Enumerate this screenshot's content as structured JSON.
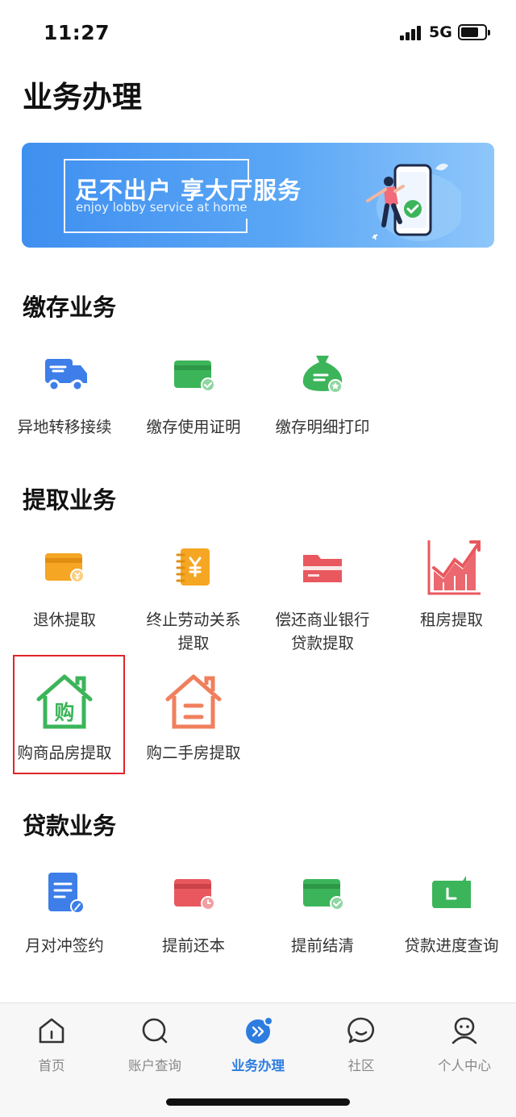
{
  "status": {
    "time": "11:27",
    "network": "5G",
    "battery_level": 0.75
  },
  "page_title": "业务办理",
  "banner": {
    "main_text": "足不出户  享大厅服务",
    "sub_text": "enjoy lobby service at home"
  },
  "sections": {
    "deposit": {
      "title": "缴存业务",
      "items": [
        {
          "label": "异地转移接续",
          "icon": "truck-icon"
        },
        {
          "label": "缴存使用证明",
          "icon": "card-check-icon"
        },
        {
          "label": "缴存明细打印",
          "icon": "money-bag-icon"
        }
      ]
    },
    "withdraw": {
      "title": "提取业务",
      "items": [
        {
          "label": "退休提取",
          "icon": "wallet-yen-icon"
        },
        {
          "label": "终止劳动关系\n提取",
          "icon": "notebook-yen-icon"
        },
        {
          "label": "偿还商业银行\n贷款提取",
          "icon": "folder-card-icon"
        },
        {
          "label": "租房提取",
          "icon": "rising-chart-icon"
        },
        {
          "label": "购商品房提取",
          "icon": "house-gou-icon",
          "icon_glyph": "购"
        },
        {
          "label": "购二手房提取",
          "icon": "house-outline-icon"
        }
      ]
    },
    "loan": {
      "title": "贷款业务",
      "items": [
        {
          "label": "月对冲签约",
          "icon": "document-pen-icon"
        },
        {
          "label": "提前还本",
          "icon": "card-clock-icon"
        },
        {
          "label": "提前结清",
          "icon": "card-check-green-icon"
        },
        {
          "label": "贷款进度查询",
          "icon": "wallet-progress-icon"
        }
      ]
    }
  },
  "tabbar": {
    "active_index": 2,
    "items": [
      {
        "label": "首页",
        "icon": "home-icon"
      },
      {
        "label": "账户查询",
        "icon": "search-icon"
      },
      {
        "label": "业务办理",
        "icon": "business-icon"
      },
      {
        "label": "社区",
        "icon": "chat-bubble-icon"
      },
      {
        "label": "个人中心",
        "icon": "user-icon"
      }
    ]
  },
  "colors": {
    "accent_blue": "#2d7de0",
    "highlight_red": "#e0242a",
    "icon_green": "#3cb55a",
    "icon_red": "#e8585e",
    "icon_orange": "#f5a623",
    "icon_blue": "#3d7ee8"
  }
}
